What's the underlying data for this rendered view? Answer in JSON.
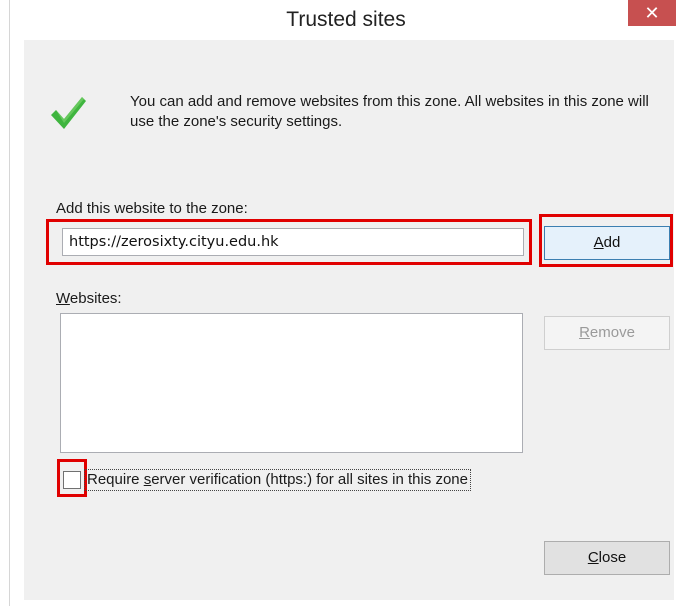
{
  "window": {
    "title": "Trusted sites",
    "close_glyph": "✕"
  },
  "info": {
    "text": "You can add and remove websites from this zone. All websites in this zone will use the zone's security settings.",
    "icon": "checkmark-icon"
  },
  "add_section": {
    "label_prefix": "Add this website to the zone:",
    "url_value": "https://zerosixty.cityu.edu.hk",
    "add_button": {
      "accel": "A",
      "rest": "dd"
    }
  },
  "websites": {
    "label_accel": "W",
    "label_rest": "ebsites:",
    "items": [],
    "remove_button": {
      "accel": "R",
      "rest": "emove"
    }
  },
  "verification": {
    "checked": false,
    "label_before": "Require ",
    "label_accel": "s",
    "label_after": "erver verification (https:) for all sites in this zone"
  },
  "footer": {
    "close_button": {
      "accel": "C",
      "rest": "lose"
    }
  },
  "colors": {
    "highlight": "#e00000",
    "close_button_bg": "#c75050",
    "check_green": "#3fb53f"
  }
}
